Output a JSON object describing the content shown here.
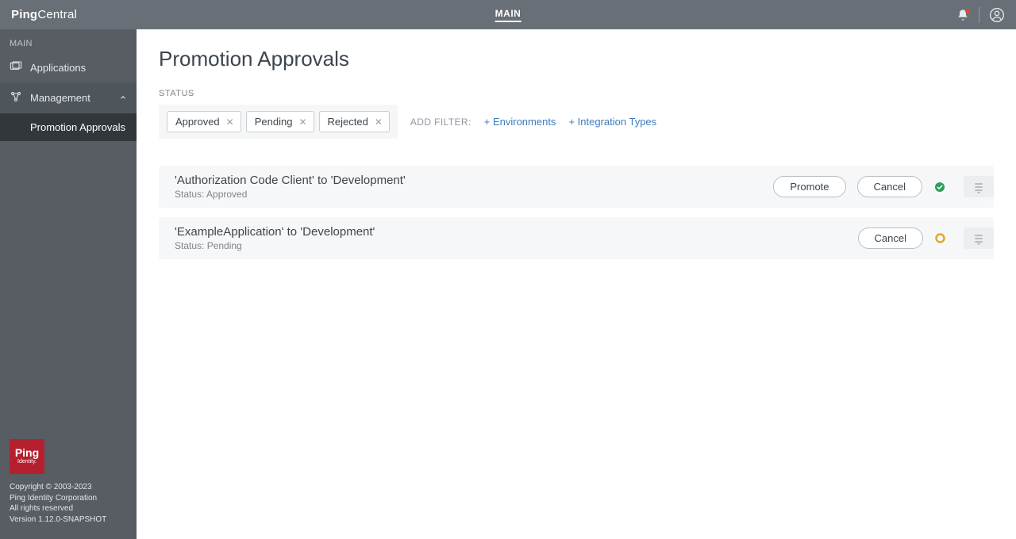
{
  "brand": {
    "text_bold": "Ping",
    "text_rest": "Central",
    "badge_l1": "Ping",
    "badge_l2": "Identity."
  },
  "header": {
    "nav_main": "MAIN"
  },
  "sidebar": {
    "section": "MAIN",
    "items": [
      {
        "label": "Applications"
      },
      {
        "label": "Management"
      }
    ],
    "subitem": "Promotion Approvals",
    "footer": {
      "copyright": "Copyright © 2003-2023",
      "company": "Ping Identity Corporation",
      "rights": "All rights reserved",
      "version": "Version 1.12.0-SNAPSHOT"
    }
  },
  "page": {
    "title": "Promotion Approvals",
    "status_label": "STATUS",
    "chips": [
      "Approved",
      "Pending",
      "Rejected"
    ],
    "add_filter_label": "ADD FILTER:",
    "add_filter_links": [
      "Environments",
      "Integration Types"
    ],
    "rows": [
      {
        "title": "'Authorization Code Client' to 'Development'",
        "status": "Status: Approved",
        "buttons": [
          "Promote",
          "Cancel"
        ],
        "state": "approved"
      },
      {
        "title": "'ExampleApplication' to 'Development'",
        "status": "Status: Pending",
        "buttons": [
          "Cancel"
        ],
        "state": "pending"
      }
    ]
  }
}
